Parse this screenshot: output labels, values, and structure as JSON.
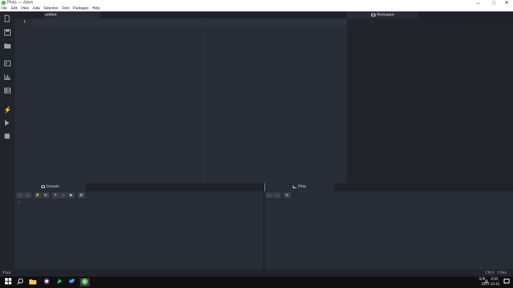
{
  "window": {
    "title": "Plots — Atom"
  },
  "menu": [
    "File",
    "Edit",
    "View",
    "Julia",
    "Selection",
    "Find",
    "Packages",
    "Help"
  ],
  "editor": {
    "tab": "untitled",
    "line_number": "1"
  },
  "workspace": {
    "tab": "Workspace"
  },
  "console": {
    "tab": "Console",
    "prompt": "›",
    "toolbar": [
      "↑",
      "↓",
      "⚡",
      "⊘",
      "↱",
      "↓",
      "▶",
      "⊞"
    ]
  },
  "plots": {
    "tab": "Plots",
    "toolbar": [
      "←",
      "→",
      "⊘"
    ]
  },
  "status": {
    "left": "Plots",
    "line_ending": "CRLF",
    "files": "0 files"
  },
  "taskbar": {
    "time": "6:50",
    "date": "2017-10-01",
    "ime": "A",
    "tray_label": "오후"
  },
  "icons": {
    "new_file": "new-file-icon",
    "save": "save-icon",
    "open_folder": "folder-icon",
    "terminal": "terminal-icon",
    "plot": "bar-chart-icon",
    "table": "table-icon",
    "run": "lightning-icon",
    "play": "play-icon",
    "stop": "stop-icon"
  },
  "colors": {
    "accent": "#568af2",
    "bg": "#282c34",
    "panel": "#21252b"
  }
}
